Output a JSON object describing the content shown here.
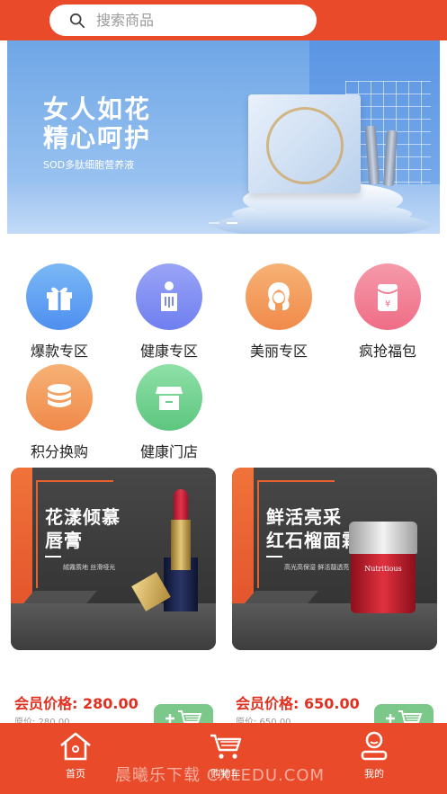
{
  "search": {
    "placeholder": "搜索商品"
  },
  "banner": {
    "title_line1": "女人如花",
    "title_line2": "精心呵护",
    "subtitle": "SOD多肽细胞营养液",
    "slide_count": 2,
    "active_slide": 2
  },
  "categories": [
    {
      "label": "爆款专区",
      "icon": "gift-icon",
      "color_from": "#7ab8f5",
      "color_to": "#4f8ff0"
    },
    {
      "label": "健康专区",
      "icon": "body-icon",
      "color_from": "#9aa4f6",
      "color_to": "#6f7ff0"
    },
    {
      "label": "美丽专区",
      "icon": "woman-face-icon",
      "color_from": "#f6b275",
      "color_to": "#f08a4a"
    },
    {
      "label": "疯抢福包",
      "icon": "red-envelope-icon",
      "color_from": "#f59aaa",
      "color_to": "#ef6d86"
    },
    {
      "label": "积分换购",
      "icon": "coins-icon",
      "color_from": "#f6b275",
      "color_to": "#f0894a"
    },
    {
      "label": "健康门店",
      "icon": "store-icon",
      "color_from": "#8fe0a7",
      "color_to": "#5dc67f"
    }
  ],
  "products": [
    {
      "title": "花漾倾慕\n唇膏",
      "tagline": "絨霧质地  丝滑哑光",
      "price": "会员价格: 280.00",
      "original_price": "原价: 280.00"
    },
    {
      "title": "鲜活亮采\n红石榴面霜",
      "tagline": "高光高保湿  鲜活靓透亮",
      "jar_label": "Nutritious",
      "price": "会员价格: 650.00",
      "original_price": "原价: 650.00"
    }
  ],
  "tabbar": {
    "items": [
      {
        "label": "首页",
        "icon": "home-icon"
      },
      {
        "label": "购物车",
        "icon": "cart-icon"
      },
      {
        "label": "我的",
        "icon": "profile-icon"
      }
    ]
  },
  "watermark": "晨曦乐下载  CXLEDU.COM",
  "colors": {
    "brand": "#e84a2a",
    "price": "#e0301f",
    "cart_button": "#7cc88a"
  }
}
